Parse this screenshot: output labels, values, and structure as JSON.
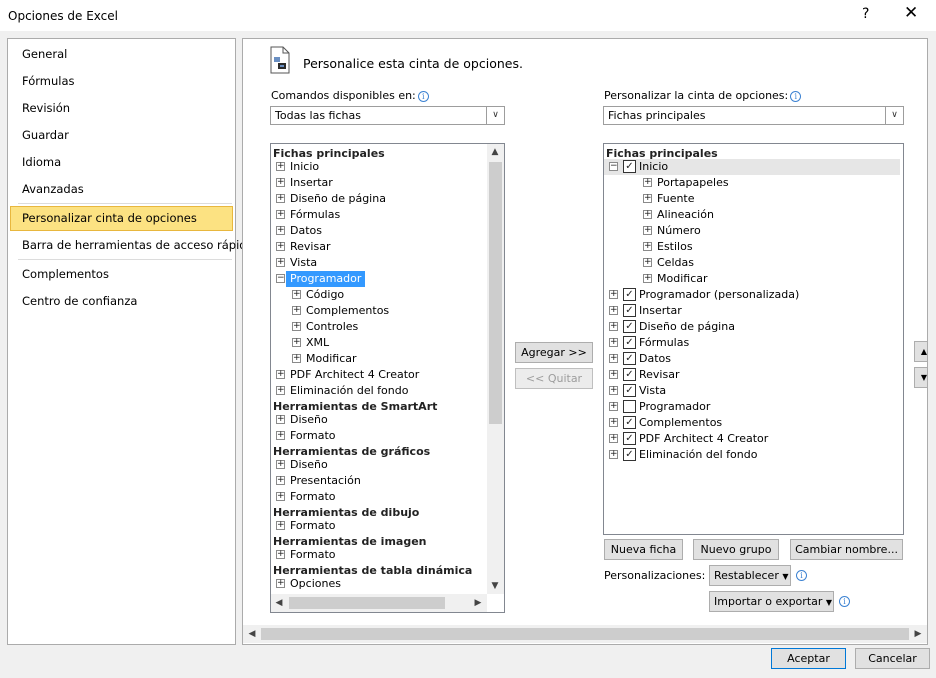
{
  "window": {
    "title": "Opciones de Excel",
    "help": "?",
    "close": "✕"
  },
  "nav": {
    "items": [
      {
        "label": "General"
      },
      {
        "label": "Fórmulas"
      },
      {
        "label": "Revisión"
      },
      {
        "label": "Guardar"
      },
      {
        "label": "Idioma"
      },
      {
        "label": "Avanzadas"
      },
      {
        "label": "Personalizar cinta de opciones",
        "selected": true
      },
      {
        "label": "Barra de herramientas de acceso rápido"
      },
      {
        "label": "Complementos"
      },
      {
        "label": "Centro de confianza"
      }
    ]
  },
  "page": {
    "heading": "Personalice esta cinta de opciones."
  },
  "left": {
    "label": "Comandos disponibles en:",
    "combo_value": "Todas las fichas",
    "list": [
      {
        "text": "Fichas principales",
        "type": "header"
      },
      {
        "text": "Inicio",
        "level": 0,
        "exp": "+"
      },
      {
        "text": "Insertar",
        "level": 0,
        "exp": "+"
      },
      {
        "text": "Diseño de página",
        "level": 0,
        "exp": "+"
      },
      {
        "text": "Fórmulas",
        "level": 0,
        "exp": "+"
      },
      {
        "text": "Datos",
        "level": 0,
        "exp": "+"
      },
      {
        "text": "Revisar",
        "level": 0,
        "exp": "+"
      },
      {
        "text": "Vista",
        "level": 0,
        "exp": "+"
      },
      {
        "text": "Programador",
        "level": 0,
        "exp": "−",
        "selected": true
      },
      {
        "text": "Código",
        "level": 1,
        "exp": "+"
      },
      {
        "text": "Complementos",
        "level": 1,
        "exp": "+"
      },
      {
        "text": "Controles",
        "level": 1,
        "exp": "+"
      },
      {
        "text": "XML",
        "level": 1,
        "exp": "+"
      },
      {
        "text": "Modificar",
        "level": 1,
        "exp": "+"
      },
      {
        "text": "PDF Architect 4 Creator",
        "level": 0,
        "exp": "+"
      },
      {
        "text": "Eliminación del fondo",
        "level": 0,
        "exp": "+"
      },
      {
        "text": "Herramientas de SmartArt",
        "type": "header"
      },
      {
        "text": "Diseño",
        "level": 0,
        "exp": "+"
      },
      {
        "text": "Formato",
        "level": 0,
        "exp": "+"
      },
      {
        "text": "Herramientas de gráficos",
        "type": "header"
      },
      {
        "text": "Diseño",
        "level": 0,
        "exp": "+"
      },
      {
        "text": "Presentación",
        "level": 0,
        "exp": "+"
      },
      {
        "text": "Formato",
        "level": 0,
        "exp": "+"
      },
      {
        "text": "Herramientas de dibujo",
        "type": "header"
      },
      {
        "text": "Formato",
        "level": 0,
        "exp": "+"
      },
      {
        "text": "Herramientas de imagen",
        "type": "header"
      },
      {
        "text": "Formato",
        "level": 0,
        "exp": "+"
      },
      {
        "text": "Herramientas de tabla dinámica",
        "type": "header"
      },
      {
        "text": "Opciones",
        "level": 0,
        "exp": "+"
      }
    ]
  },
  "right": {
    "label": "Personalizar la cinta de opciones:",
    "combo_value": "Fichas principales",
    "list": [
      {
        "text": "Fichas principales",
        "type": "header"
      },
      {
        "text": "Inicio",
        "level": 0,
        "exp": "−",
        "checked": true,
        "gray": true
      },
      {
        "text": "Portapapeles",
        "level": 1,
        "exp": "+"
      },
      {
        "text": "Fuente",
        "level": 1,
        "exp": "+"
      },
      {
        "text": "Alineación",
        "level": 1,
        "exp": "+"
      },
      {
        "text": "Número",
        "level": 1,
        "exp": "+"
      },
      {
        "text": "Estilos",
        "level": 1,
        "exp": "+"
      },
      {
        "text": "Celdas",
        "level": 1,
        "exp": "+"
      },
      {
        "text": "Modificar",
        "level": 1,
        "exp": "+"
      },
      {
        "text": "Programador (personalizada)",
        "level": 0,
        "exp": "+",
        "checked": true
      },
      {
        "text": "Insertar",
        "level": 0,
        "exp": "+",
        "checked": true
      },
      {
        "text": "Diseño de página",
        "level": 0,
        "exp": "+",
        "checked": true
      },
      {
        "text": "Fórmulas",
        "level": 0,
        "exp": "+",
        "checked": true
      },
      {
        "text": "Datos",
        "level": 0,
        "exp": "+",
        "checked": true
      },
      {
        "text": "Revisar",
        "level": 0,
        "exp": "+",
        "checked": true
      },
      {
        "text": "Vista",
        "level": 0,
        "exp": "+",
        "checked": true
      },
      {
        "text": "Programador",
        "level": 0,
        "exp": "+",
        "checked": false
      },
      {
        "text": "Complementos",
        "level": 0,
        "exp": "+",
        "checked": true
      },
      {
        "text": "PDF Architect 4 Creator",
        "level": 0,
        "exp": "+",
        "checked": true
      },
      {
        "text": "Eliminación del fondo",
        "level": 0,
        "exp": "+",
        "checked": true
      }
    ]
  },
  "buttons": {
    "add": "Agregar >>",
    "remove": "<< Quitar",
    "new_tab": "Nueva ficha",
    "new_group": "Nuevo grupo",
    "rename": "Cambiar nombre...",
    "customizations_label": "Personalizaciones:",
    "reset": "Restablecer",
    "import_export": "Importar o exportar",
    "ok": "Aceptar",
    "cancel": "Cancelar"
  }
}
